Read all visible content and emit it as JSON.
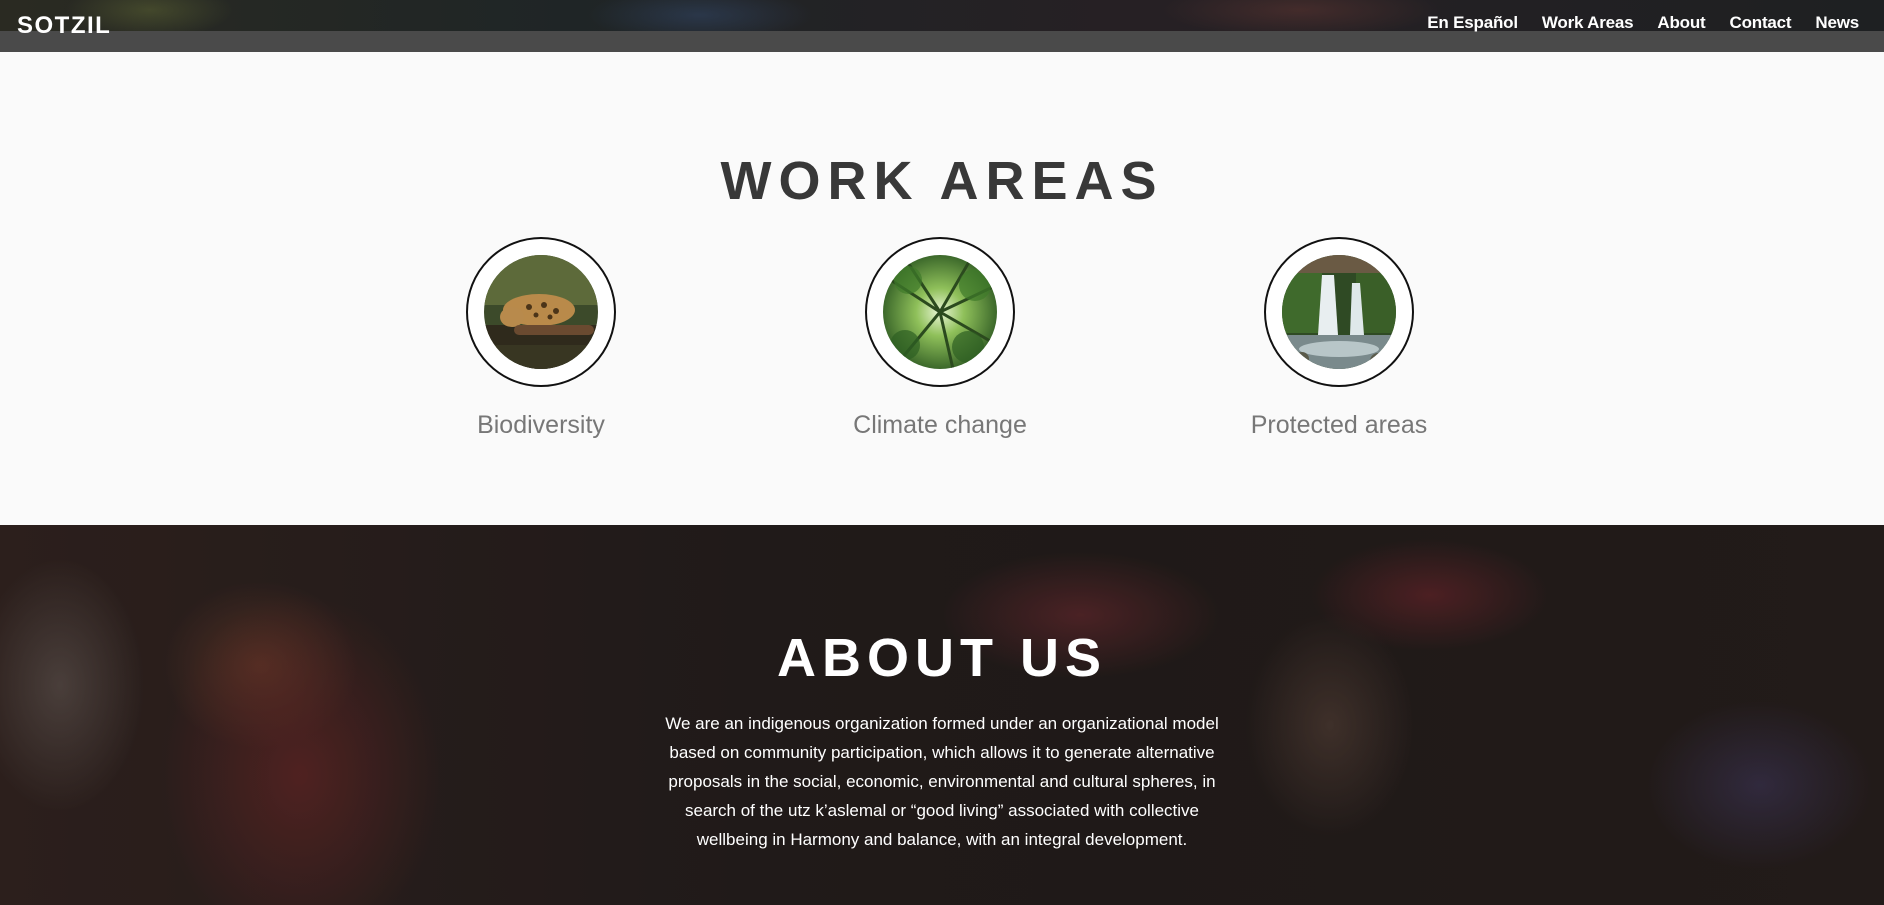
{
  "header": {
    "brand": "SOTZIL",
    "nav": [
      "En Español",
      "Work Areas",
      "About",
      "Contact",
      "News"
    ]
  },
  "work_areas": {
    "title": "WORK AREAS",
    "items": [
      {
        "label": "Biodiversity",
        "image": "jaguar-photo"
      },
      {
        "label": "Climate change",
        "image": "forest-canopy-photo"
      },
      {
        "label": "Protected areas",
        "image": "waterfall-photo"
      }
    ]
  },
  "about": {
    "title": "ABOUT US",
    "text": "We are an indigenous organization formed under an organizational model based on community participation, which allows it to generate alternative proposals in the social, economic, environmental and cultural spheres, in search of the utz k’aslemal or “good living” associated with collective wellbeing in Harmony and balance, with an integral development."
  },
  "colors": {
    "heading": "#383838",
    "label": "#777777",
    "nav_text": "#ffffff",
    "strip": "#4a4a4a"
  }
}
